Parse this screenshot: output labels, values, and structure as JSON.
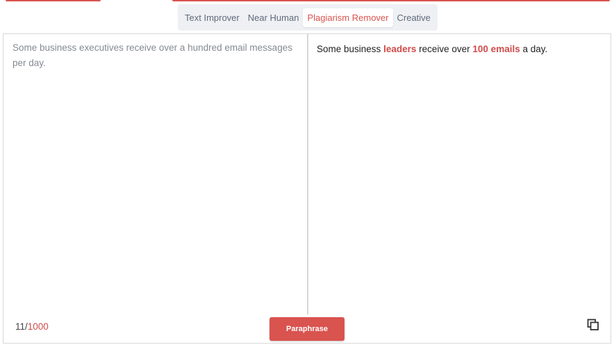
{
  "tabs": [
    {
      "label": "Text Improver",
      "active": false
    },
    {
      "label": "Near Human",
      "active": false
    },
    {
      "label": "Plagiarism Remover",
      "active": true
    },
    {
      "label": "Creative",
      "active": false
    }
  ],
  "input": {
    "text": "Some business executives receive over a hundred email messages per day."
  },
  "output": {
    "part1": "Some business ",
    "highlight1": "leaders",
    "part2": " receive over ",
    "highlight2": "100 emails",
    "part3": " a day."
  },
  "counter": {
    "current": "11",
    "separator": "/",
    "max": "1000"
  },
  "actions": {
    "paraphrase_label": "Paraphrase",
    "copy_icon": "copy-icon"
  },
  "colors": {
    "accent": "#d9534f",
    "highlight": "#d04a4a"
  }
}
